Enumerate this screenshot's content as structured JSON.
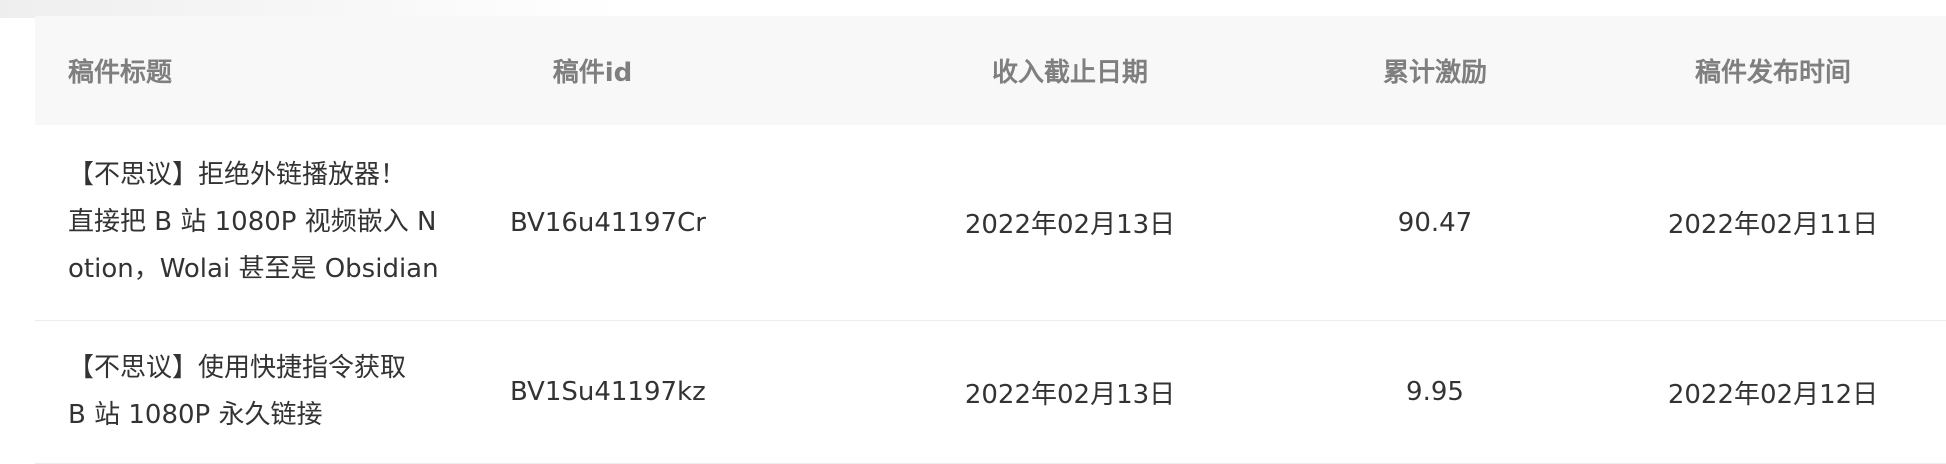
{
  "table": {
    "headers": {
      "title": "稿件标题",
      "id": "稿件id",
      "cutoff_date": "收入截止日期",
      "reward": "累计激励",
      "publish_time": "稿件发布时间"
    },
    "rows": [
      {
        "title_lines": [
          "【不思议】拒绝外链播放器！",
          "直接把 B 站 1080P 视频嵌入 N",
          "otion，Wolai 甚至是 Obsidian"
        ],
        "id": "BV16u41197Cr",
        "cutoff_date": "2022年02月13日",
        "reward": "90.47",
        "publish_time": "2022年02月11日"
      },
      {
        "title_lines": [
          "【不思议】使用快捷指令获取",
          "B 站 1080P 永久链接"
        ],
        "id": "BV1Su41197kz",
        "cutoff_date": "2022年02月13日",
        "reward": "9.95",
        "publish_time": "2022年02月12日"
      }
    ]
  }
}
